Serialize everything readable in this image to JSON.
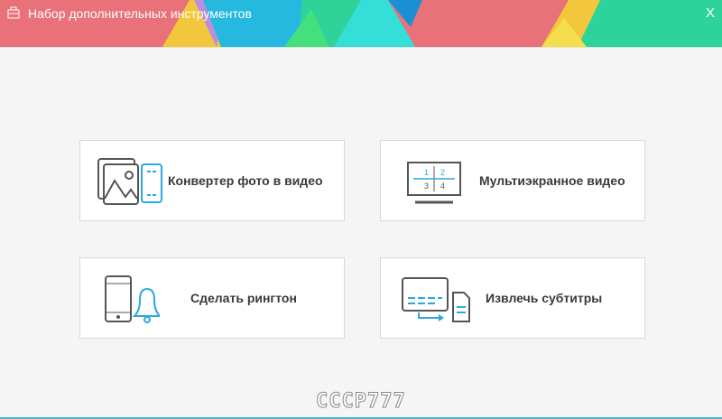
{
  "window": {
    "title": "Набор дополнительных инструментов",
    "close": "X"
  },
  "tools": [
    {
      "label": "Конвертер фото в видео",
      "icon": "photo-to-video-icon"
    },
    {
      "label": "Мультиэкранное видео",
      "icon": "multiscreen-icon",
      "grid": [
        "1",
        "2",
        "3",
        "4"
      ]
    },
    {
      "label": "Сделать рингтон",
      "icon": "phone-bell-icon"
    },
    {
      "label": "Извлечь субтитры",
      "icon": "extract-subtitles-icon"
    }
  ],
  "watermark": "CCCP777",
  "colors": {
    "accent": "#29a9df",
    "header_red": "#e8717a",
    "icon_gray": "#555555"
  }
}
